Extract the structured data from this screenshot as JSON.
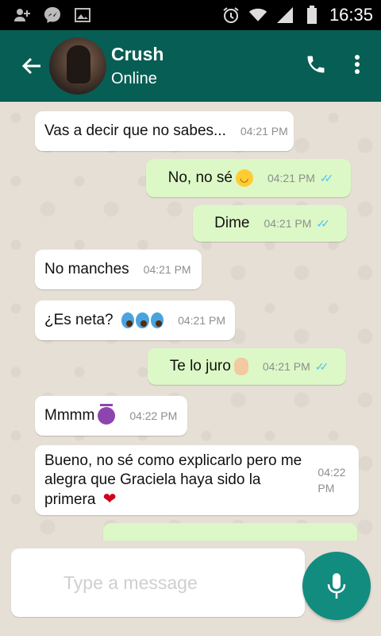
{
  "status_bar": {
    "time": "16:35",
    "icons": [
      "add-user-icon",
      "messenger-icon",
      "image-icon",
      "alarm-icon",
      "wifi-icon",
      "signal-icon",
      "battery-icon"
    ]
  },
  "app_bar": {
    "contact_name": "Crush",
    "contact_status": "Online",
    "icons": [
      "back-arrow-icon",
      "phone-icon",
      "more-vert-icon"
    ],
    "color": "#075e54"
  },
  "messages": [
    {
      "direction": "in",
      "text": "Vas a decir que no sabes...",
      "time": "04:21 PM"
    },
    {
      "direction": "out",
      "text": "No, no sé",
      "emoji": "grinning-face",
      "time": "04:21 PM",
      "read": true
    },
    {
      "direction": "out",
      "text": "Dime",
      "time": "04:21 PM",
      "read": true
    },
    {
      "direction": "in",
      "text": "No manches",
      "time": "04:21 PM"
    },
    {
      "direction": "in",
      "text": "¿Es neta?",
      "emoji": "screaming-face x3",
      "time": "04:21 PM"
    },
    {
      "direction": "out",
      "text": "Te lo juro",
      "emoji": "raised-hand",
      "time": "04:21 PM",
      "read": true
    },
    {
      "direction": "in",
      "text": "Mmmm",
      "emoji": "smiling-devil",
      "time": "04:22 PM"
    },
    {
      "direction": "in",
      "text": "Bueno, no sé como explicarlo pero me alegra que Graciela haya sido la primera",
      "emoji": "heart",
      "time": "04:22 PM"
    }
  ],
  "colors": {
    "incoming": "#ffffff",
    "outgoing": "#dcf8c6",
    "read_ticks": "#4fc3f7",
    "mic_button": "#128c7e"
  },
  "composer": {
    "placeholder": "Type a message"
  }
}
